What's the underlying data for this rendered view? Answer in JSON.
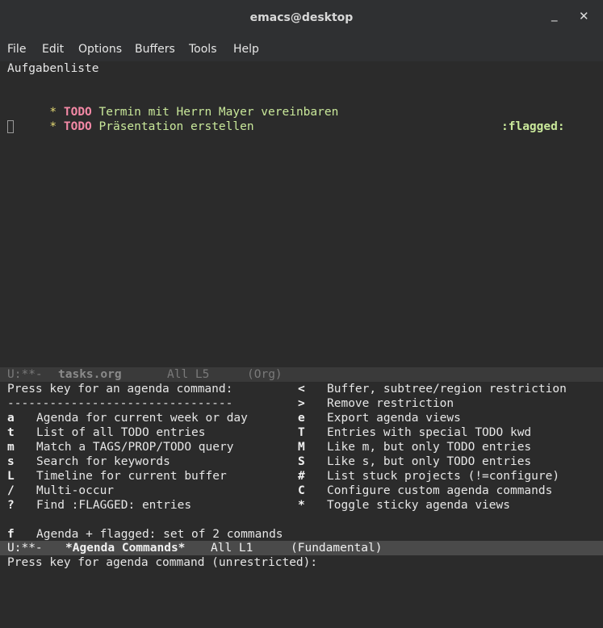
{
  "window": {
    "title": "emacs@desktop",
    "minimize_glyph": "_",
    "close_glyph": "✕"
  },
  "menu": [
    "File",
    "Edit",
    "Options",
    "Buffers",
    "Tools",
    "Help"
  ],
  "buffer_top": {
    "heading": "Aufgabenliste",
    "entries": [
      {
        "star": "*",
        "keyword": "TODO",
        "text": "Termin mit Herrn Mayer vereinbaren",
        "tag": ":flagged:"
      },
      {
        "star": "*",
        "keyword": "TODO",
        "text": "Präsentation erstellen",
        "tag": ""
      }
    ]
  },
  "modeline_top": {
    "status": "U:**-",
    "buffer_name": "tasks.org",
    "position": "All L5",
    "mode": "(Org)"
  },
  "agenda": {
    "prompt": "Press key for an agenda command:",
    "separator": "--------------------------------",
    "left": [
      {
        "key": "a",
        "desc": "Agenda for current week or day"
      },
      {
        "key": "t",
        "desc": "List of all TODO entries"
      },
      {
        "key": "m",
        "desc": "Match a TAGS/PROP/TODO query"
      },
      {
        "key": "s",
        "desc": "Search for keywords"
      },
      {
        "key": "L",
        "desc": "Timeline for current buffer"
      },
      {
        "key": "/",
        "desc": "Multi-occur"
      },
      {
        "key": "?",
        "desc": "Find :FLAGGED: entries"
      }
    ],
    "right": [
      {
        "key": "<",
        "desc": "Buffer, subtree/region restriction"
      },
      {
        "key": ">",
        "desc": "Remove restriction"
      },
      {
        "key": "e",
        "desc": "Export agenda views"
      },
      {
        "key": "T",
        "desc": "Entries with special TODO kwd"
      },
      {
        "key": "M",
        "desc": "Like m, but only TODO entries"
      },
      {
        "key": "S",
        "desc": "Like s, but only TODO entries"
      },
      {
        "key": "#",
        "desc": "List stuck projects (!=configure)"
      },
      {
        "key": "C",
        "desc": "Configure custom agenda commands"
      },
      {
        "key": "*",
        "desc": "Toggle sticky agenda views"
      }
    ],
    "extra": {
      "key": "f",
      "desc": "Agenda + flagged: set of 2 commands"
    }
  },
  "modeline_bottom": {
    "status": "U:**-",
    "buffer_name": "*Agenda Commands*",
    "position": "All L1",
    "mode": "(Fundamental)"
  },
  "minibuffer": {
    "prompt": "Press key for agenda command (unrestricted):"
  }
}
